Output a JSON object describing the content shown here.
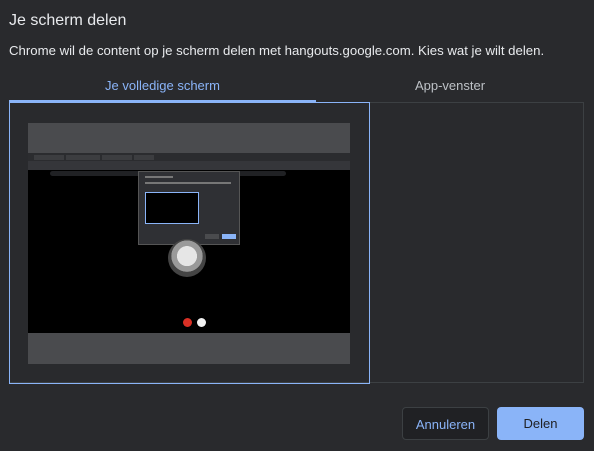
{
  "dialog": {
    "title": "Je scherm delen",
    "subtitle": "Chrome wil de content op je scherm delen met hangouts.google.com. Kies wat je wilt delen."
  },
  "tabs": [
    {
      "label": "Je volledige scherm",
      "active": true
    },
    {
      "label": "App-venster",
      "active": false
    }
  ],
  "buttons": {
    "cancel_label": "Annuleren",
    "share_label": "Delen"
  },
  "colors": {
    "accent": "#8ab4f8",
    "background": "#292a2d",
    "end_call": "#d93025"
  }
}
